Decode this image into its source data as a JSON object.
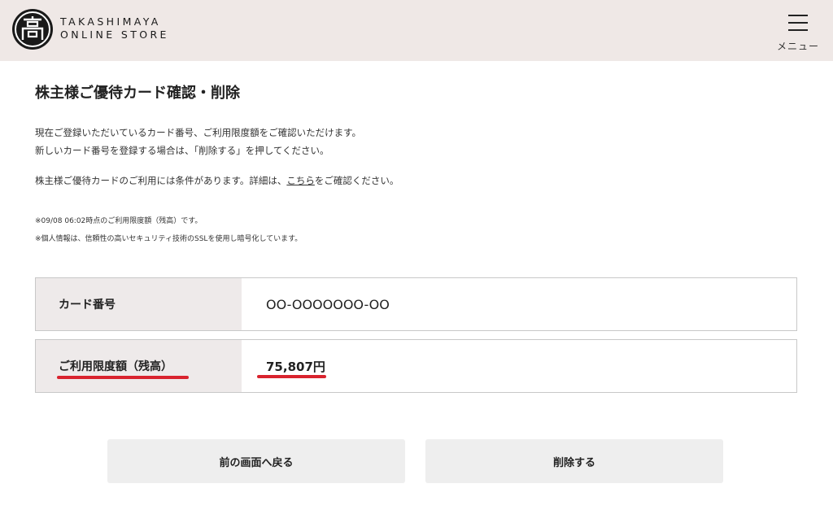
{
  "header": {
    "logo_line1": "TAKASHIMAYA",
    "logo_line2": "ONLINE STORE",
    "menu_label": "メニュー"
  },
  "page": {
    "title": "株主様ご優待カード確認・削除",
    "desc_line1": "現在ご登録いただいているカード番号、ご利用限度額をご確認いただけます。",
    "desc_line2": "新しいカード番号を登録する場合は、「削除する」を押してください。",
    "desc3_before": "株主様ご優待カードのご利用には条件があります。詳細は、",
    "desc3_link": "こちら",
    "desc3_after": "をご確認ください。",
    "note1": "※09/08 06:02時点のご利用限度額（残高）です。",
    "note2": "※個人情報は、信頼性の高いセキュリティ技術のSSLを使用し暗号化しています。"
  },
  "card_table": {
    "card_number_label": "カード番号",
    "card_number_value": "OO-OOOOOOO-OO",
    "limit_label": "ご利用限度額（残高）",
    "limit_value": "75,807円"
  },
  "buttons": {
    "back": "前の画面へ戻る",
    "delete": "削除する"
  },
  "colors": {
    "header_bg": "#efe8e6",
    "label_bg": "#eeeaea",
    "highlight": "#d9232e",
    "button_bg": "#eeeeee"
  },
  "icons": [
    "takashimaya-logo-icon",
    "hamburger-menu-icon"
  ]
}
